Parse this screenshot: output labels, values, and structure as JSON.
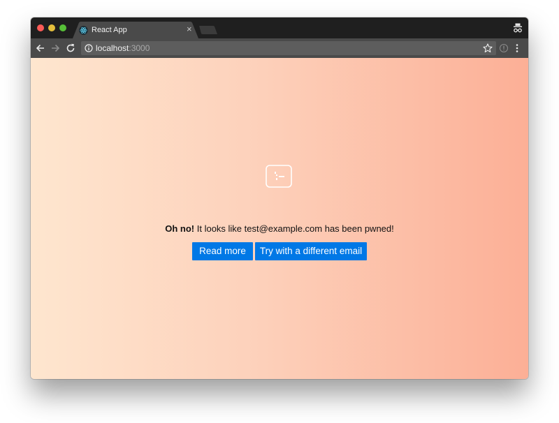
{
  "browser": {
    "tab_title": "React App",
    "tab_close": "×",
    "url_host": "localhost",
    "url_port": ":3000"
  },
  "icons": {
    "favicon": "react-logo-icon",
    "back": "arrow-left-icon",
    "forward": "arrow-right-icon",
    "reload": "reload-icon",
    "site_info": "info-icon",
    "bookmark": "star-icon",
    "extension": "extension-icon",
    "menu": "vertical-dots-icon",
    "incognito": "incognito-icon",
    "hero": "terminal-icon"
  },
  "page": {
    "message_bold": "Oh no!",
    "message_rest": " It looks like test@example.com has been pwned!",
    "read_more_label": "Read more",
    "try_again_label": "Try with a different email"
  },
  "colors": {
    "button_bg": "#0078e6",
    "gradient_start": "#fee6cf",
    "gradient_end": "#fcaf96",
    "titlebar": "#1f1f1f",
    "toolbar": "#4a4a4a"
  }
}
